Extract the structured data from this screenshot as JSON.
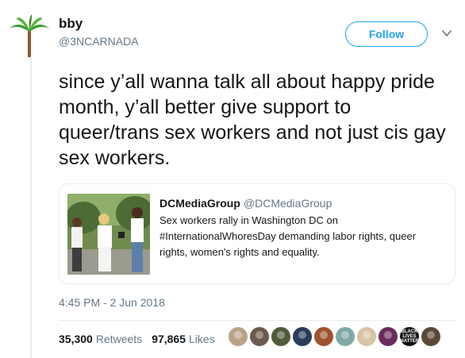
{
  "author": {
    "display_name": "bby",
    "handle": "@3NCARNADA",
    "avatar_icon": "palm-tree-icon"
  },
  "follow_label": "Follow",
  "tweet_text": "since y’all wanna talk all about happy pride month, y’all better give support to queer/trans sex workers and not just cis gay sex workers.",
  "quoted": {
    "display_name": "DCMediaGroup",
    "handle": "@DCMediaGroup",
    "text": "Sex workers rally in Washington DC on #InternationalWhoresDay demanding labor rights, queer rights, women's rights and equality."
  },
  "timestamp": "4:45 PM - 2 Jun 2018",
  "stats": {
    "retweets_count": "35,300",
    "retweets_label": "Retweets",
    "likes_count": "97,865",
    "likes_label": "Likes"
  },
  "likers": [
    {
      "name": "liker-1",
      "color": "#b9a48a"
    },
    {
      "name": "liker-2",
      "color": "#6b5a4e"
    },
    {
      "name": "liker-3",
      "color": "#4f5b3a"
    },
    {
      "name": "liker-4",
      "color": "#2a3d5c"
    },
    {
      "name": "liker-5",
      "color": "#a0522d"
    },
    {
      "name": "liker-6",
      "color": "#7fa9a6"
    },
    {
      "name": "liker-7",
      "color": "#d8c3a5"
    },
    {
      "name": "liker-8",
      "color": "#6a2c5e"
    },
    {
      "name": "liker-9",
      "color": "#111111",
      "text": "BLACK LIVES MATTER"
    },
    {
      "name": "liker-10",
      "color": "#5a4a35"
    }
  ],
  "colors": {
    "accent": "#1da1f2",
    "muted": "#657786",
    "border": "#e6ecf0"
  }
}
